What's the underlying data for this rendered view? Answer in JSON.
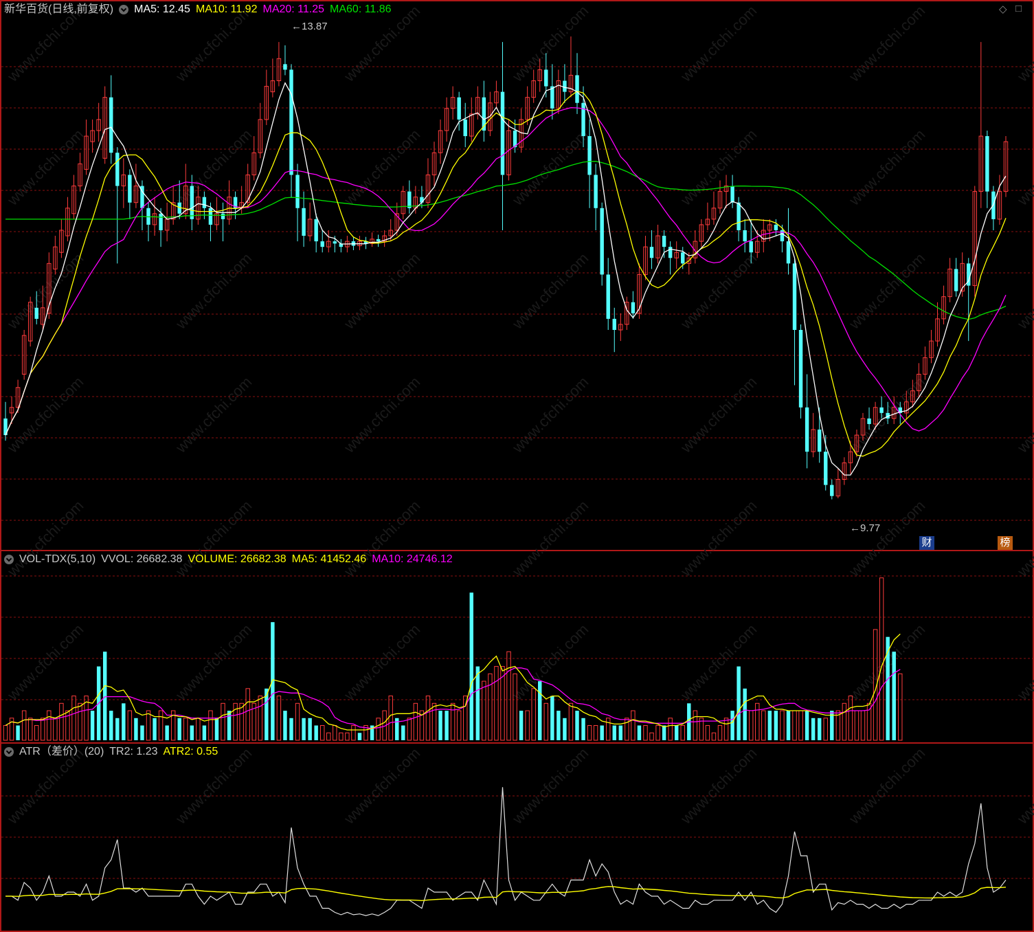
{
  "colors": {
    "up": "#ff3c3c",
    "down": "#54ffff",
    "ma5": "#ffffff",
    "ma10": "#ffff00",
    "ma20": "#ff00ff",
    "ma60": "#00e000",
    "grid": "#8a1010",
    "border": "#b01818",
    "watermark": "#1a1a1a"
  },
  "main_panel": {
    "title": "新华百货(日线,前复权)",
    "ma5_label": "MA5: 12.45",
    "ma10_label": "MA10: 11.92",
    "ma20_label": "MA20: 11.25",
    "ma60_label": "MA60: 11.86",
    "high_label": "13.87",
    "low_label": "9.77",
    "badge_cai": "财",
    "badge_bang": "榜"
  },
  "vol_panel": {
    "title": "VOL-TDX(5,10)",
    "vvol_label": "VVOL: 26682.38",
    "volume_label": "VOLUME: 26682.38",
    "ma5_label": "MA5: 41452.46",
    "ma10_label": "MA10: 24746.12"
  },
  "atr_panel": {
    "title": "ATR（差价）(20)",
    "tr_label": "TR2: 1.23",
    "atr_label": "ATR2: 0.55"
  },
  "watermark": "www.cfchi.com",
  "chart_data": {
    "type": "candlestick",
    "price_range": [
      9.5,
      14.0
    ],
    "candles": [
      [
        10.5,
        10.35,
        10.65,
        10.3
      ],
      [
        10.55,
        10.6,
        10.7,
        10.45
      ],
      [
        10.6,
        10.78,
        10.85,
        10.55
      ],
      [
        10.9,
        11.25,
        11.3,
        10.85
      ],
      [
        11.2,
        11.55,
        11.6,
        11.15
      ],
      [
        11.5,
        11.4,
        11.65,
        11.35
      ],
      [
        11.35,
        11.5,
        11.7,
        11.3
      ],
      [
        11.45,
        11.9,
        12.0,
        11.4
      ],
      [
        11.85,
        12.05,
        12.15,
        11.8
      ],
      [
        12.0,
        12.2,
        12.3,
        11.95
      ],
      [
        12.15,
        12.4,
        12.5,
        12.1
      ],
      [
        12.35,
        12.6,
        12.7,
        12.3
      ],
      [
        12.6,
        12.8,
        12.9,
        12.55
      ],
      [
        12.75,
        13.05,
        13.2,
        12.7
      ],
      [
        13.0,
        13.1,
        13.2,
        12.9
      ],
      [
        13.1,
        13.2,
        13.35,
        13.0
      ],
      [
        12.85,
        13.4,
        13.5,
        12.8
      ],
      [
        13.4,
        12.9,
        13.6,
        12.8
      ],
      [
        12.9,
        12.6,
        12.95,
        11.9
      ],
      [
        12.6,
        12.7,
        12.85,
        12.4
      ],
      [
        12.7,
        12.45,
        12.75,
        12.3
      ],
      [
        12.45,
        12.6,
        12.8,
        12.4
      ],
      [
        12.6,
        12.4,
        12.65,
        12.2
      ],
      [
        12.4,
        12.25,
        12.45,
        12.1
      ],
      [
        12.25,
        12.35,
        12.5,
        12.15
      ],
      [
        12.35,
        12.2,
        12.4,
        12.05
      ],
      [
        12.2,
        12.3,
        12.45,
        12.1
      ],
      [
        12.3,
        12.45,
        12.6,
        12.25
      ],
      [
        12.45,
        12.35,
        12.65,
        12.3
      ],
      [
        12.35,
        12.6,
        12.8,
        12.3
      ],
      [
        12.6,
        12.3,
        12.7,
        12.2
      ],
      [
        12.3,
        12.5,
        12.6,
        12.25
      ],
      [
        12.5,
        12.4,
        12.55,
        12.3
      ],
      [
        12.4,
        12.25,
        12.45,
        12.1
      ],
      [
        12.25,
        12.35,
        12.5,
        12.2
      ],
      [
        12.35,
        12.3,
        12.45,
        12.1
      ],
      [
        12.3,
        12.5,
        12.65,
        12.25
      ],
      [
        12.5,
        12.4,
        12.55,
        12.3
      ],
      [
        12.4,
        12.45,
        12.6,
        12.35
      ],
      [
        12.45,
        12.7,
        12.8,
        12.4
      ],
      [
        12.7,
        12.9,
        13.05,
        12.65
      ],
      [
        12.9,
        13.2,
        13.35,
        12.85
      ],
      [
        13.2,
        13.5,
        13.65,
        13.15
      ],
      [
        13.45,
        13.55,
        13.75,
        13.4
      ],
      [
        13.55,
        13.75,
        13.9,
        13.5
      ],
      [
        13.7,
        13.65,
        13.87,
        13.6
      ],
      [
        13.65,
        12.7,
        13.7,
        12.5
      ],
      [
        12.7,
        12.4,
        12.8,
        12.1
      ],
      [
        12.4,
        12.15,
        12.55,
        12.05
      ],
      [
        12.15,
        12.3,
        12.45,
        12.1
      ],
      [
        12.3,
        12.1,
        12.35,
        12.0
      ],
      [
        12.1,
        12.05,
        12.2,
        12.0
      ],
      [
        12.05,
        12.1,
        12.2,
        12.0
      ],
      [
        12.1,
        12.08,
        12.15,
        12.0
      ],
      [
        12.08,
        12.05,
        12.12,
        12.0
      ],
      [
        12.05,
        12.1,
        12.15,
        12.0
      ],
      [
        12.1,
        12.06,
        12.14,
        12.02
      ],
      [
        12.06,
        12.1,
        12.15,
        12.02
      ],
      [
        12.1,
        12.08,
        12.14,
        12.03
      ],
      [
        12.08,
        12.12,
        12.18,
        12.05
      ],
      [
        12.12,
        12.1,
        12.16,
        12.05
      ],
      [
        12.1,
        12.15,
        12.2,
        12.05
      ],
      [
        12.15,
        12.2,
        12.3,
        12.1
      ],
      [
        12.2,
        12.35,
        12.45,
        12.15
      ],
      [
        12.35,
        12.55,
        12.6,
        12.3
      ],
      [
        12.55,
        12.4,
        12.65,
        12.35
      ],
      [
        12.4,
        12.5,
        12.6,
        12.35
      ],
      [
        12.5,
        12.45,
        12.6,
        12.4
      ],
      [
        12.45,
        12.7,
        12.85,
        12.4
      ],
      [
        12.7,
        12.9,
        13.0,
        12.6
      ],
      [
        12.9,
        13.1,
        13.2,
        12.8
      ],
      [
        13.1,
        13.3,
        13.4,
        13.0
      ],
      [
        13.3,
        13.4,
        13.5,
        13.2
      ],
      [
        13.4,
        13.2,
        13.45,
        13.1
      ],
      [
        13.2,
        13.05,
        13.35,
        12.95
      ],
      [
        13.05,
        13.25,
        13.4,
        13.0
      ],
      [
        13.25,
        13.4,
        13.5,
        13.2
      ],
      [
        13.4,
        13.1,
        13.55,
        13.0
      ],
      [
        13.1,
        13.35,
        13.45,
        13.05
      ],
      [
        13.35,
        13.45,
        13.55,
        13.3
      ],
      [
        13.45,
        12.7,
        13.9,
        12.2
      ],
      [
        12.7,
        13.1,
        13.2,
        12.65
      ],
      [
        13.1,
        12.95,
        13.2,
        12.9
      ],
      [
        12.95,
        13.2,
        13.3,
        12.9
      ],
      [
        13.2,
        13.4,
        13.5,
        13.15
      ],
      [
        13.4,
        13.55,
        13.65,
        13.35
      ],
      [
        13.55,
        13.65,
        13.75,
        13.45
      ],
      [
        13.65,
        13.5,
        13.8,
        13.4
      ],
      [
        13.5,
        13.3,
        13.7,
        13.2
      ],
      [
        13.3,
        13.55,
        13.65,
        13.25
      ],
      [
        13.55,
        13.45,
        13.7,
        13.35
      ],
      [
        13.45,
        13.6,
        13.95,
        13.4
      ],
      [
        13.6,
        13.35,
        13.8,
        13.25
      ],
      [
        13.35,
        13.05,
        13.5,
        12.95
      ],
      [
        13.05,
        12.7,
        13.2,
        12.4
      ],
      [
        12.7,
        12.4,
        12.8,
        12.2
      ],
      [
        12.4,
        11.8,
        12.45,
        11.7
      ],
      [
        11.8,
        11.4,
        11.95,
        11.3
      ],
      [
        11.4,
        11.3,
        11.5,
        11.1
      ],
      [
        11.3,
        11.35,
        11.45,
        11.2
      ],
      [
        11.35,
        11.55,
        11.6,
        11.3
      ],
      [
        11.55,
        11.45,
        11.65,
        11.4
      ],
      [
        11.45,
        11.8,
        11.9,
        11.4
      ],
      [
        11.8,
        12.05,
        12.15,
        11.75
      ],
      [
        12.05,
        11.95,
        12.2,
        11.85
      ],
      [
        11.95,
        12.15,
        12.25,
        11.9
      ],
      [
        12.15,
        12.05,
        12.2,
        11.95
      ],
      [
        12.05,
        11.95,
        12.1,
        11.8
      ],
      [
        11.95,
        12.0,
        12.1,
        11.85
      ],
      [
        12.0,
        11.9,
        12.05,
        11.85
      ],
      [
        11.9,
        11.95,
        12.0,
        11.8
      ],
      [
        11.95,
        12.1,
        12.2,
        11.9
      ],
      [
        12.1,
        12.25,
        12.3,
        12.05
      ],
      [
        12.25,
        12.3,
        12.45,
        12.2
      ],
      [
        12.3,
        12.4,
        12.55,
        12.25
      ],
      [
        12.4,
        12.55,
        12.65,
        12.35
      ],
      [
        12.55,
        12.6,
        12.7,
        12.4
      ],
      [
        12.6,
        12.45,
        12.7,
        12.4
      ],
      [
        12.45,
        12.2,
        12.5,
        12.1
      ],
      [
        12.2,
        12.1,
        12.3,
        12.0
      ],
      [
        12.1,
        12.0,
        12.3,
        11.9
      ],
      [
        12.0,
        12.1,
        12.2,
        11.95
      ],
      [
        12.1,
        12.2,
        12.3,
        12.0
      ],
      [
        12.2,
        12.25,
        12.3,
        12.1
      ],
      [
        12.25,
        12.2,
        12.3,
        12.15
      ],
      [
        12.2,
        12.1,
        12.25,
        12.0
      ],
      [
        12.1,
        11.9,
        12.4,
        11.8
      ],
      [
        11.9,
        11.3,
        11.95,
        10.8
      ],
      [
        11.3,
        10.6,
        11.35,
        10.5
      ],
      [
        10.6,
        10.2,
        10.9,
        10.05
      ],
      [
        10.2,
        10.4,
        10.55,
        10.15
      ],
      [
        10.4,
        10.2,
        10.6,
        10.1
      ],
      [
        10.2,
        9.9,
        10.35,
        9.85
      ],
      [
        9.9,
        9.8,
        9.95,
        9.77
      ],
      [
        9.8,
        9.95,
        10.05,
        9.78
      ],
      [
        9.95,
        10.1,
        10.15,
        9.9
      ],
      [
        10.1,
        10.2,
        10.3,
        10.0
      ],
      [
        10.2,
        10.35,
        10.4,
        10.15
      ],
      [
        10.35,
        10.5,
        10.55,
        10.3
      ],
      [
        10.5,
        10.45,
        10.6,
        10.4
      ],
      [
        10.45,
        10.6,
        10.65,
        10.4
      ],
      [
        10.6,
        10.55,
        10.7,
        10.5
      ],
      [
        10.55,
        10.5,
        10.65,
        10.45
      ],
      [
        10.5,
        10.6,
        10.7,
        10.45
      ],
      [
        10.6,
        10.55,
        10.65,
        10.45
      ],
      [
        10.55,
        10.65,
        10.75,
        10.5
      ],
      [
        10.65,
        10.75,
        10.85,
        10.6
      ],
      [
        10.75,
        10.9,
        11.0,
        10.7
      ],
      [
        10.9,
        11.05,
        11.15,
        10.85
      ],
      [
        11.05,
        11.2,
        11.3,
        11.0
      ],
      [
        11.2,
        11.4,
        11.55,
        11.15
      ],
      [
        11.4,
        11.6,
        11.7,
        11.35
      ],
      [
        11.6,
        11.85,
        11.95,
        11.55
      ],
      [
        11.85,
        11.65,
        11.95,
        11.6
      ],
      [
        11.65,
        11.9,
        12.0,
        11.6
      ],
      [
        11.9,
        11.7,
        11.95,
        11.2
      ],
      [
        11.7,
        12.55,
        12.6,
        11.6
      ],
      [
        12.55,
        13.05,
        13.9,
        12.4
      ],
      [
        13.05,
        12.55,
        13.1,
        12.4
      ],
      [
        12.55,
        12.3,
        12.6,
        12.2
      ],
      [
        12.3,
        12.55,
        12.7,
        12.25
      ],
      [
        12.55,
        13.0,
        13.05,
        12.5
      ]
    ],
    "volume": [
      [
        2,
        1
      ],
      [
        3,
        1
      ],
      [
        2,
        0
      ],
      [
        4,
        1
      ],
      [
        3,
        1
      ],
      [
        2,
        1
      ],
      [
        3,
        1
      ],
      [
        4,
        1
      ],
      [
        3,
        1
      ],
      [
        5,
        1
      ],
      [
        4,
        1
      ],
      [
        6,
        1
      ],
      [
        5,
        1
      ],
      [
        6,
        1
      ],
      [
        4,
        0
      ],
      [
        10,
        0
      ],
      [
        12,
        0
      ],
      [
        4,
        0
      ],
      [
        3,
        0
      ],
      [
        5,
        0
      ],
      [
        4,
        1
      ],
      [
        3,
        0
      ],
      [
        2,
        0
      ],
      [
        4,
        1
      ],
      [
        3,
        0
      ],
      [
        4,
        1
      ],
      [
        2,
        0
      ],
      [
        4,
        1
      ],
      [
        3,
        0
      ],
      [
        3,
        1
      ],
      [
        2,
        0
      ],
      [
        3,
        1
      ],
      [
        2,
        0
      ],
      [
        4,
        1
      ],
      [
        3,
        0
      ],
      [
        5,
        1
      ],
      [
        4,
        0
      ],
      [
        5,
        1
      ],
      [
        5,
        1
      ],
      [
        7,
        1
      ],
      [
        5,
        1
      ],
      [
        6,
        1
      ],
      [
        7,
        0
      ],
      [
        16,
        0
      ],
      [
        6,
        1
      ],
      [
        4,
        0
      ],
      [
        3,
        0
      ],
      [
        5,
        1
      ],
      [
        3,
        0
      ],
      [
        3,
        0
      ],
      [
        2,
        0
      ],
      [
        2,
        1
      ],
      [
        1,
        1
      ],
      [
        2,
        1
      ],
      [
        1,
        1
      ],
      [
        1,
        1
      ],
      [
        2,
        1
      ],
      [
        1,
        0
      ],
      [
        2,
        1
      ],
      [
        2,
        0
      ],
      [
        3,
        1
      ],
      [
        4,
        1
      ],
      [
        6,
        1
      ],
      [
        3,
        0
      ],
      [
        2,
        0
      ],
      [
        3,
        1
      ],
      [
        5,
        1
      ],
      [
        4,
        1
      ],
      [
        6,
        1
      ],
      [
        5,
        1
      ],
      [
        4,
        0
      ],
      [
        4,
        0
      ],
      [
        5,
        1
      ],
      [
        4,
        1
      ],
      [
        6,
        1
      ],
      [
        20,
        0
      ],
      [
        10,
        0
      ],
      [
        8,
        1
      ],
      [
        9,
        1
      ],
      [
        10,
        1
      ],
      [
        10,
        1
      ],
      [
        12,
        1
      ],
      [
        9,
        1
      ],
      [
        4,
        0
      ],
      [
        4,
        1
      ],
      [
        7,
        1
      ],
      [
        8,
        0
      ],
      [
        5,
        1
      ],
      [
        6,
        0
      ],
      [
        4,
        0
      ],
      [
        3,
        0
      ],
      [
        5,
        1
      ],
      [
        4,
        0
      ],
      [
        3,
        0
      ],
      [
        2,
        1
      ],
      [
        2,
        1
      ],
      [
        2,
        0
      ],
      [
        3,
        1
      ],
      [
        2,
        0
      ],
      [
        2,
        0
      ],
      [
        3,
        1
      ],
      [
        4,
        1
      ],
      [
        2,
        0
      ],
      [
        2,
        1
      ],
      [
        1,
        1
      ],
      [
        2,
        1
      ],
      [
        2,
        0
      ],
      [
        3,
        1
      ],
      [
        2,
        0
      ],
      [
        2,
        1
      ],
      [
        5,
        0
      ],
      [
        4,
        1
      ],
      [
        3,
        1
      ],
      [
        2,
        1
      ],
      [
        1,
        1
      ],
      [
        2,
        1
      ],
      [
        3,
        1
      ],
      [
        4,
        0
      ],
      [
        10,
        0
      ],
      [
        7,
        0
      ],
      [
        4,
        1
      ],
      [
        5,
        1
      ],
      [
        4,
        1
      ],
      [
        4,
        0
      ],
      [
        4,
        0
      ],
      [
        4,
        1
      ],
      [
        4,
        0
      ],
      [
        4,
        1
      ],
      [
        4,
        1
      ],
      [
        4,
        0
      ],
      [
        3,
        0
      ],
      [
        3,
        0
      ],
      [
        3,
        1
      ],
      [
        4,
        0
      ],
      [
        4,
        1
      ],
      [
        5,
        1
      ],
      [
        6,
        1
      ],
      [
        4,
        1
      ],
      [
        4,
        1
      ],
      [
        5,
        1
      ],
      [
        15,
        1
      ],
      [
        22,
        1
      ],
      [
        14,
        0
      ],
      [
        12,
        0
      ],
      [
        9,
        1
      ]
    ],
    "atr": {
      "tr2_last": 1.23,
      "atr2_last": 0.55
    }
  }
}
